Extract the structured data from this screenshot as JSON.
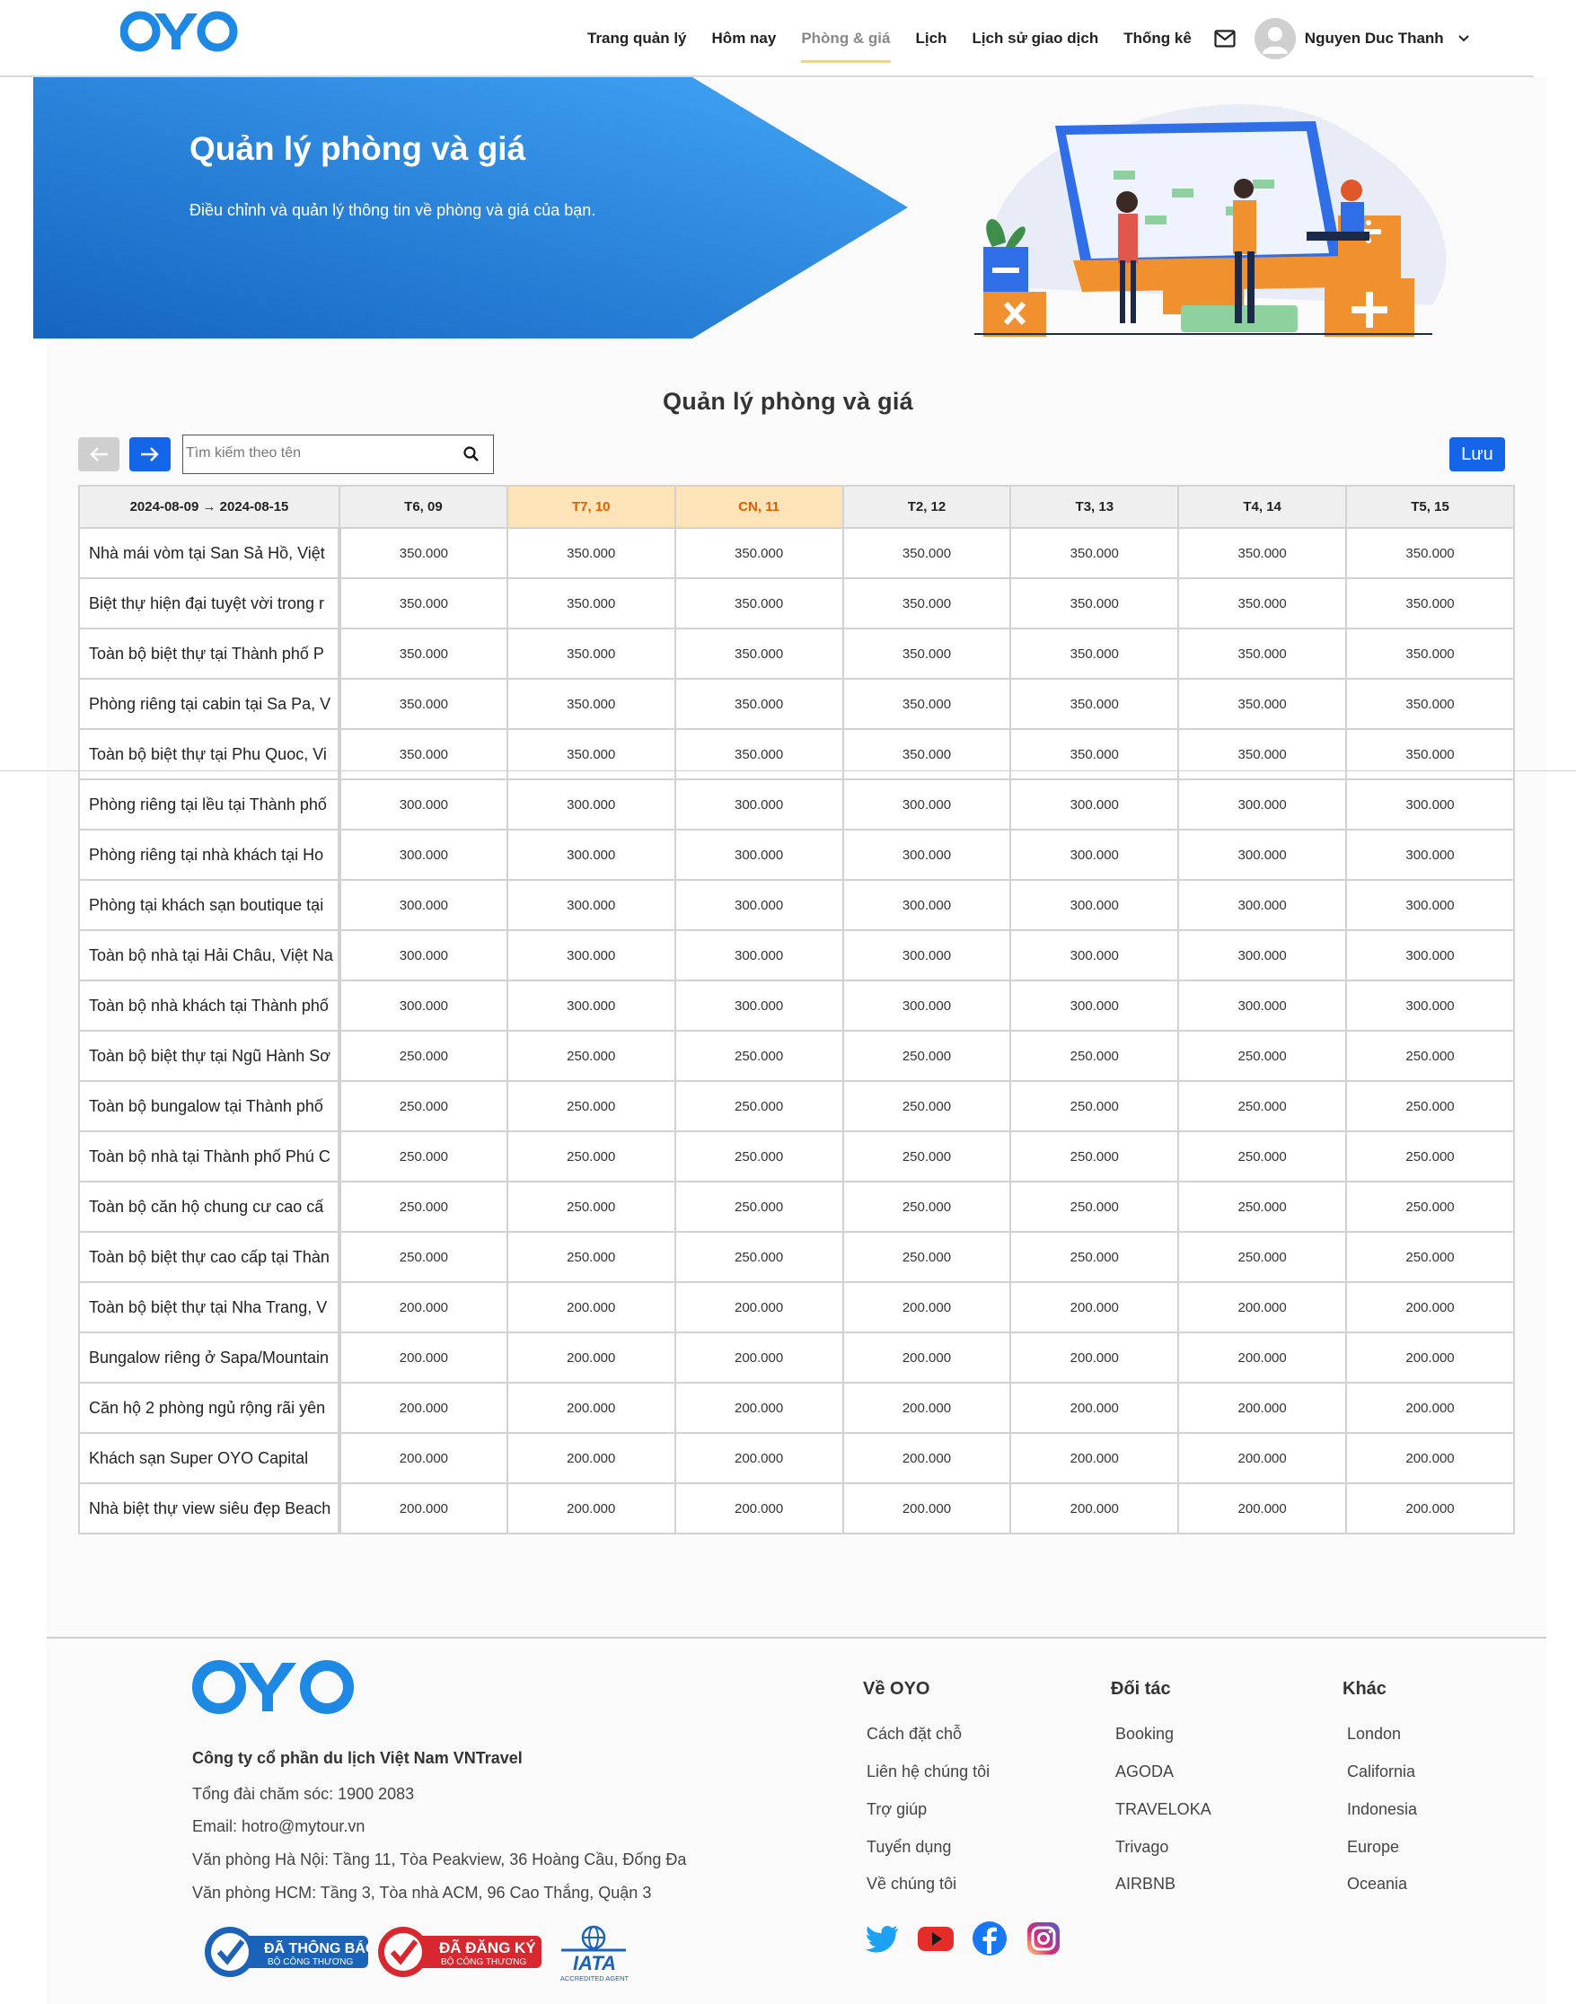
{
  "header": {
    "nav": [
      "Trang quản lý",
      "Hôm nay",
      "Phòng & giá",
      "Lịch",
      "Lịch sử giao dịch",
      "Thống kê"
    ],
    "active_nav": "Phòng & giá",
    "user_name": "Nguyen Duc Thanh"
  },
  "banner": {
    "title": "Quản lý phòng và giá",
    "subtitle": "Điều chỉnh và quản lý thông tin về phòng và giá của bạn."
  },
  "section": {
    "title": "Quản lý phòng và giá",
    "search_placeholder": "Tìm kiếm theo tên",
    "save_label": "Lưu"
  },
  "table": {
    "range": "2024-08-09 → 2024-08-15",
    "days": [
      {
        "label": "T6, 09",
        "weekend": false
      },
      {
        "label": "T7, 10",
        "weekend": true
      },
      {
        "label": "CN, 11",
        "weekend": true
      },
      {
        "label": "T2, 12",
        "weekend": false
      },
      {
        "label": "T3, 13",
        "weekend": false
      },
      {
        "label": "T4, 14",
        "weekend": false
      },
      {
        "label": "T5, 15",
        "weekend": false
      }
    ],
    "rows": [
      {
        "name": "Nhà mái vòm tại San Sả Hồ, Việt",
        "price": "350.000"
      },
      {
        "name": "Biệt thự hiện đại tuyệt vời trong r",
        "price": "350.000"
      },
      {
        "name": "Toàn bộ biệt thự tại Thành phố P",
        "price": "350.000"
      },
      {
        "name": "Phòng riêng tại cabin tại Sa Pa, V",
        "price": "350.000"
      },
      {
        "name": "Toàn bộ biệt thự tại Phu Quoc, Vi",
        "price": "350.000"
      },
      {
        "name": "Phòng riêng tại lều tại Thành phố",
        "price": "300.000"
      },
      {
        "name": "Phòng riêng tại nhà khách tại Ho",
        "price": "300.000"
      },
      {
        "name": "Phòng tại khách sạn boutique tại",
        "price": "300.000"
      },
      {
        "name": "Toàn bộ nhà tại Hải Châu, Việt Na",
        "price": "300.000"
      },
      {
        "name": "Toàn bộ nhà khách tại Thành phố",
        "price": "300.000"
      },
      {
        "name": "Toàn bộ biệt thự tại Ngũ Hành Sơ",
        "price": "250.000"
      },
      {
        "name": "Toàn bộ bungalow tại Thành phố",
        "price": "250.000"
      },
      {
        "name": "Toàn bộ nhà tại Thành phố Phú C",
        "price": "250.000"
      },
      {
        "name": "Toàn bộ căn hộ chung cư cao cấ",
        "price": "250.000"
      },
      {
        "name": "Toàn bộ biệt thự cao cấp tại Thàn",
        "price": "250.000"
      },
      {
        "name": "Toàn bộ biệt thự tại Nha Trang, V",
        "price": "200.000"
      },
      {
        "name": "Bungalow riêng ở Sapa/Mountain",
        "price": "200.000"
      },
      {
        "name": "Căn hộ 2 phòng ngủ rộng rãi yên",
        "price": "200.000"
      },
      {
        "name": "Khách sạn Super OYO Capital",
        "price": "200.000"
      },
      {
        "name": "Nhà biệt thự view siêu đẹp Beach",
        "price": "200.000"
      }
    ]
  },
  "footer": {
    "company": "Công ty cổ phần du lịch Việt Nam VNTravel",
    "hotline": "Tổng đài chăm sóc: 1900 2083",
    "email": "Email: hotro@mytour.vn",
    "office_hn": "Văn phòng Hà Nội: Tầng 11, Tòa Peakview, 36 Hoàng Cầu, Đống Đa",
    "office_hcm": "Văn phòng HCM: Tầng 3, Tòa nhà ACM, 96 Cao Thắng, Quận 3",
    "col1_title": "Về OYO",
    "col1": [
      "Cách đặt chỗ",
      "Liên hệ chúng tôi",
      "Trợ giúp",
      "Tuyển dụng",
      "Về chúng tôi"
    ],
    "col2_title": "Đối tác",
    "col2": [
      "Booking",
      "AGODA",
      "TRAVELOKA",
      "Trivago",
      "AIRBNB"
    ],
    "col3_title": "Khác",
    "col3": [
      "London",
      "California",
      "Indonesia",
      "Europe",
      "Oceania"
    ],
    "badges": {
      "b1_main": "ĐÃ THÔNG BÁO",
      "b1_sub": "BỘ CÔNG THƯƠNG",
      "b2_main": "ĐÃ ĐĂNG KÝ",
      "b2_sub": "BỘ CÔNG THƯƠNG",
      "iata": "IATA",
      "iata_sub": "ACCREDITED AGENT"
    }
  },
  "colors": {
    "primary": "#1565e8",
    "oyo_blue": "#1e88e5",
    "weekend_bg": "#fde3b8",
    "weekend_text": "#e35d00"
  }
}
